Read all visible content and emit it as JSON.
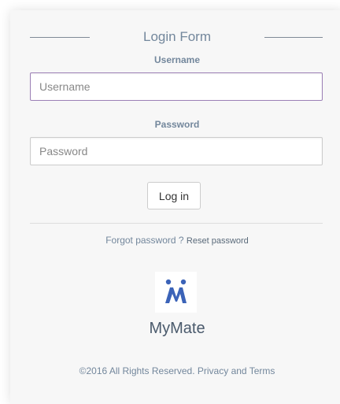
{
  "form": {
    "title": "Login Form",
    "username_label": "Username",
    "username_placeholder": "Username",
    "password_label": "Password",
    "password_placeholder": "Password",
    "login_label": "Log in"
  },
  "links": {
    "forgot_text": "Forgot password ?",
    "reset_text": "Reset password"
  },
  "brand": {
    "name": "MyMate",
    "logo_icon": "two-people-logo",
    "logo_color": "#3b63b8"
  },
  "footer": {
    "copyright": "©2016 All Rights Reserved.",
    "privacy": "Privacy and Terms"
  }
}
